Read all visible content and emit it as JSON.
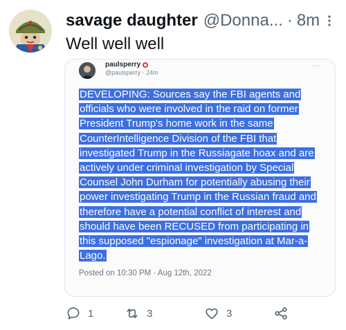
{
  "tweet": {
    "display_name": "savage daughter",
    "handle": "@Donna...",
    "separator": "·",
    "time": "8m",
    "text": "Well well well"
  },
  "quoted": {
    "name": "paulsperry",
    "handle": "@paulsperry",
    "time": "24m",
    "more": "···",
    "lines": [
      "DEVELOPING: Sources say the FBI agents and",
      "officials who were involved in the raid on former",
      "President Trump's home work in the same",
      "CounterIntelligence Division of the FBI that",
      "investigated Trump in the Russiagate hoax and are",
      "actively under criminal investigation by Special",
      "Counsel John Durham for potentially abusing their",
      "power investigating Trump in the Russian fraud and",
      "therefore have a potential conflict of interest and",
      "should have been RECUSED from participating in",
      "this supposed \"espionage\" investigation at Mar-a-",
      "Lago."
    ],
    "posted": "Posted on 10:30 PM · Aug 12th, 2022",
    "accent_color": "#3d6fe0"
  },
  "actions": {
    "reply_count": "1",
    "retweet_count": "3",
    "like_count": "3"
  }
}
